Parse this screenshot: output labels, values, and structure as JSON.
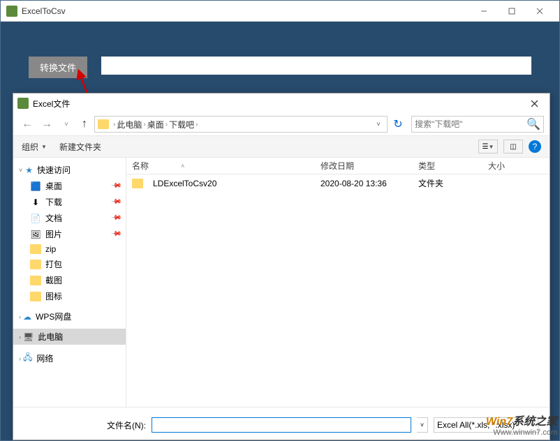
{
  "app": {
    "title": "ExcelToCsv"
  },
  "main": {
    "convert_label": "转换文件"
  },
  "dialog": {
    "title": "Excel文件",
    "breadcrumb": [
      "此电脑",
      "桌面",
      "下载吧"
    ],
    "search_placeholder": "搜索\"下载吧\"",
    "toolbar": {
      "organize": "组织",
      "new_folder": "新建文件夹"
    },
    "columns": {
      "name": "名称",
      "date": "修改日期",
      "type": "类型",
      "size": "大小"
    },
    "rows": [
      {
        "name": "LDExcelToCsv20",
        "date": "2020-08-20 13:36",
        "type": "文件夹",
        "size": ""
      }
    ],
    "sidebar": {
      "quick": "快速访问",
      "quick_items": [
        {
          "label": "桌面",
          "icon": "desktop",
          "pinned": true
        },
        {
          "label": "下载",
          "icon": "downloads",
          "pinned": true
        },
        {
          "label": "文档",
          "icon": "documents",
          "pinned": true
        },
        {
          "label": "图片",
          "icon": "pictures",
          "pinned": true
        },
        {
          "label": "zip",
          "icon": "folder",
          "pinned": false
        },
        {
          "label": "打包",
          "icon": "folder",
          "pinned": false
        },
        {
          "label": "截图",
          "icon": "folder",
          "pinned": false
        },
        {
          "label": "图标",
          "icon": "folder",
          "pinned": false
        }
      ],
      "wps": "WPS网盘",
      "thispc": "此电脑",
      "network": "网络"
    },
    "footer": {
      "filename_label": "文件名(N):",
      "filter": "Excel All(*.xls, *.xlsx)"
    }
  },
  "watermark": {
    "line1a": "Win7",
    "line1b": "系统之家",
    "line2": "Www.winwin7.com"
  }
}
